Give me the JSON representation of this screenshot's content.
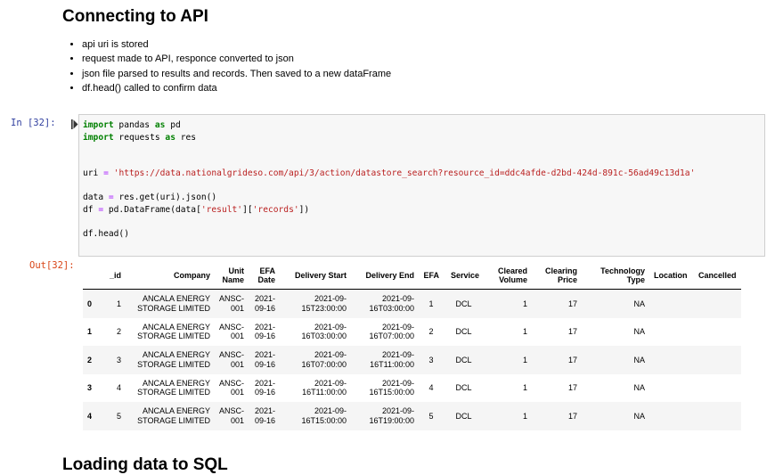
{
  "heading": "Connecting to API",
  "next_heading": "Loading data to SQL",
  "bullets": [
    "api uri is stored",
    "request made to API, responce converted to json",
    "json file parsed to results and records. Then saved to a new dataFrame",
    "df.head() called to confirm data"
  ],
  "cell": {
    "in_prompt": "In [32]:",
    "out_prompt": "Out[32]:",
    "code": {
      "l1_kw1": "import",
      "l1_mid": " pandas ",
      "l1_kw2": "as",
      "l1_end": " pd",
      "l2_kw1": "import",
      "l2_mid": " requests ",
      "l2_kw2": "as",
      "l2_end": " res",
      "l5_var": "uri ",
      "l5_eq": "=",
      "l5_str": " 'https://data.nationalgrideso.com/api/3/action/datastore_search?resource_id=ddc4afde-d2bd-424d-891c-56ad49c13d1a'",
      "l7_a": "data ",
      "l7_eq": "=",
      "l7_b": " res.get(uri).json()",
      "l8_a": "df ",
      "l8_eq": "=",
      "l8_b": " pd.DataFrame(data[",
      "l8_s1": "'result'",
      "l8_c": "][",
      "l8_s2": "'records'",
      "l8_d": "])",
      "l10": "df.head()"
    }
  },
  "table": {
    "columns": [
      "",
      "_id",
      "Company",
      "Unit Name",
      "EFA Date",
      "Delivery Start",
      "Delivery End",
      "EFA",
      "Service",
      "Cleared Volume",
      "Clearing Price",
      "Technology Type",
      "Location",
      "Cancelled"
    ],
    "header_lines": {
      "company": "Company",
      "unit_name_1": "Unit",
      "unit_name_2": "Name",
      "efa_date_1": "EFA",
      "efa_date_2": "Date",
      "cleared_1": "Cleared",
      "cleared_2": "Volume",
      "clearing_1": "Clearing",
      "clearing_2": "Price",
      "tech_1": "Technology",
      "tech_2": "Type"
    },
    "rows": [
      {
        "idx": "0",
        "id": "1",
        "company1": "ANCALA ENERGY",
        "company2": "STORAGE LIMITED",
        "unit1": "ANSC-",
        "unit2": "001",
        "date1": "2021-",
        "date2": "09-16",
        "start1": "2021-09-",
        "start2": "15T23:00:00",
        "end1": "2021-09-",
        "end2": "16T03:00:00",
        "efa": "1",
        "service": "DCL",
        "volume": "1",
        "price": "17",
        "tech": "NA",
        "location": "",
        "cancelled": ""
      },
      {
        "idx": "1",
        "id": "2",
        "company1": "ANCALA ENERGY",
        "company2": "STORAGE LIMITED",
        "unit1": "ANSC-",
        "unit2": "001",
        "date1": "2021-",
        "date2": "09-16",
        "start1": "2021-09-",
        "start2": "16T03:00:00",
        "end1": "2021-09-",
        "end2": "16T07:00:00",
        "efa": "2",
        "service": "DCL",
        "volume": "1",
        "price": "17",
        "tech": "NA",
        "location": "",
        "cancelled": ""
      },
      {
        "idx": "2",
        "id": "3",
        "company1": "ANCALA ENERGY",
        "company2": "STORAGE LIMITED",
        "unit1": "ANSC-",
        "unit2": "001",
        "date1": "2021-",
        "date2": "09-16",
        "start1": "2021-09-",
        "start2": "16T07:00:00",
        "end1": "2021-09-",
        "end2": "16T11:00:00",
        "efa": "3",
        "service": "DCL",
        "volume": "1",
        "price": "17",
        "tech": "NA",
        "location": "",
        "cancelled": ""
      },
      {
        "idx": "3",
        "id": "4",
        "company1": "ANCALA ENERGY",
        "company2": "STORAGE LIMITED",
        "unit1": "ANSC-",
        "unit2": "001",
        "date1": "2021-",
        "date2": "09-16",
        "start1": "2021-09-",
        "start2": "16T11:00:00",
        "end1": "2021-09-",
        "end2": "16T15:00:00",
        "efa": "4",
        "service": "DCL",
        "volume": "1",
        "price": "17",
        "tech": "NA",
        "location": "",
        "cancelled": ""
      },
      {
        "idx": "4",
        "id": "5",
        "company1": "ANCALA ENERGY",
        "company2": "STORAGE LIMITED",
        "unit1": "ANSC-",
        "unit2": "001",
        "date1": "2021-",
        "date2": "09-16",
        "start1": "2021-09-",
        "start2": "16T15:00:00",
        "end1": "2021-09-",
        "end2": "16T19:00:00",
        "efa": "5",
        "service": "DCL",
        "volume": "1",
        "price": "17",
        "tech": "NA",
        "location": "",
        "cancelled": ""
      }
    ]
  },
  "colors": {
    "in_prompt": "#303f9f",
    "out_prompt": "#d84315",
    "keyword": "#008000",
    "string": "#ba2121"
  }
}
